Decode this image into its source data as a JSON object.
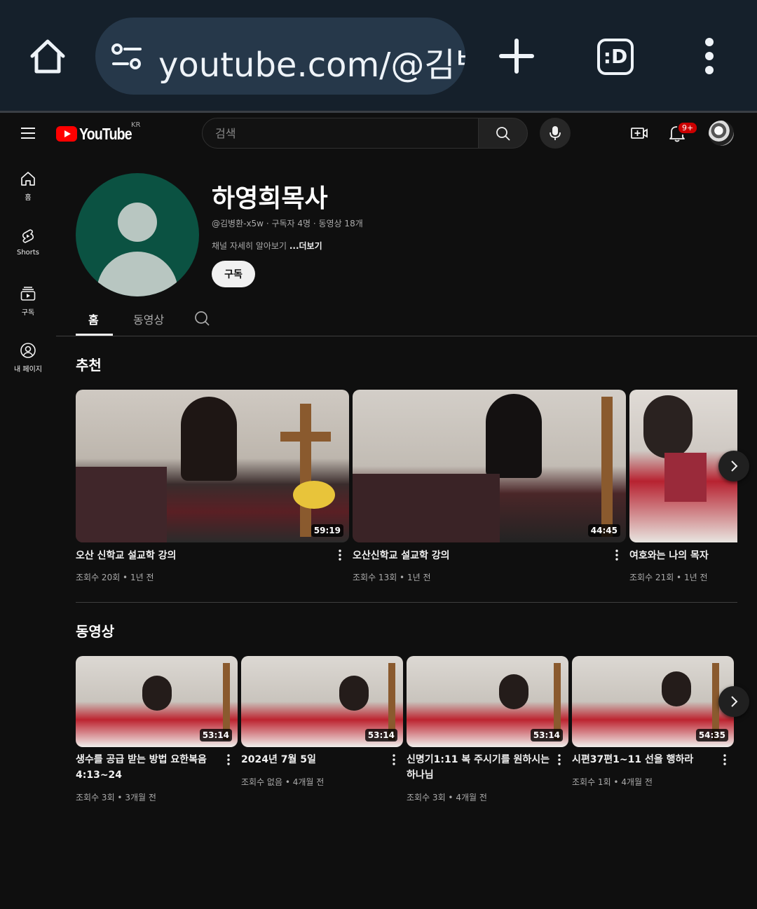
{
  "browser": {
    "url": "youtube.com/@김병",
    "tab_switcher_label": ":D",
    "icons": [
      "home-icon",
      "site-settings-icon",
      "new-tab-icon",
      "tab-switcher-icon",
      "more-vert-icon"
    ]
  },
  "header": {
    "logo_text": "YouTube",
    "region": "KR",
    "search_placeholder": "검색",
    "notification_badge": "9+"
  },
  "sidebar": {
    "items": [
      {
        "label": "홈",
        "icon": "home-icon"
      },
      {
        "label": "Shorts",
        "icon": "shorts-icon"
      },
      {
        "label": "구독",
        "icon": "subscriptions-icon"
      },
      {
        "label": "내 페이지",
        "icon": "you-icon"
      }
    ]
  },
  "channel": {
    "name": "하영희목사",
    "meta": "@김병환-x5w · 구독자 4명 · 동영상 18개",
    "description": "채널 자세히 알아보기",
    "more_label": "...더보기",
    "subscribe_label": "구독",
    "avatar_color": "#0b5242"
  },
  "tabs": [
    {
      "label": "홈",
      "active": true
    },
    {
      "label": "동영상",
      "active": false
    }
  ],
  "sections": {
    "recommended": {
      "title": "추천",
      "videos": [
        {
          "title": "오산 신학교 설교학 강의",
          "meta": "조회수 20회 • 1년 전",
          "duration": "59:19"
        },
        {
          "title": "오산신학교 설교학 강의",
          "meta": "조회수 13회 • 1년 전",
          "duration": "44:45"
        },
        {
          "title": "여호와는 나의 목자",
          "meta": "조회수 21회 • 1년 전",
          "duration": ""
        }
      ]
    },
    "videos": {
      "title": "동영상",
      "videos": [
        {
          "title": "생수를 공급 받는 방법 요한복음 4:13~24",
          "meta": "조회수 3회 • 3개월 전",
          "duration": "53:14"
        },
        {
          "title": "2024년 7월 5일",
          "meta": "조회수 없음 • 4개월 전",
          "duration": "53:14"
        },
        {
          "title": "신명기1:11 복 주시기를 원하시는 하나님",
          "meta": "조회수 3회 • 4개월 전",
          "duration": "53:14"
        },
        {
          "title": "시편37편1~11 선을 행하라",
          "meta": "조회수 1회 • 4개월 전",
          "duration": "54:35"
        }
      ]
    }
  }
}
